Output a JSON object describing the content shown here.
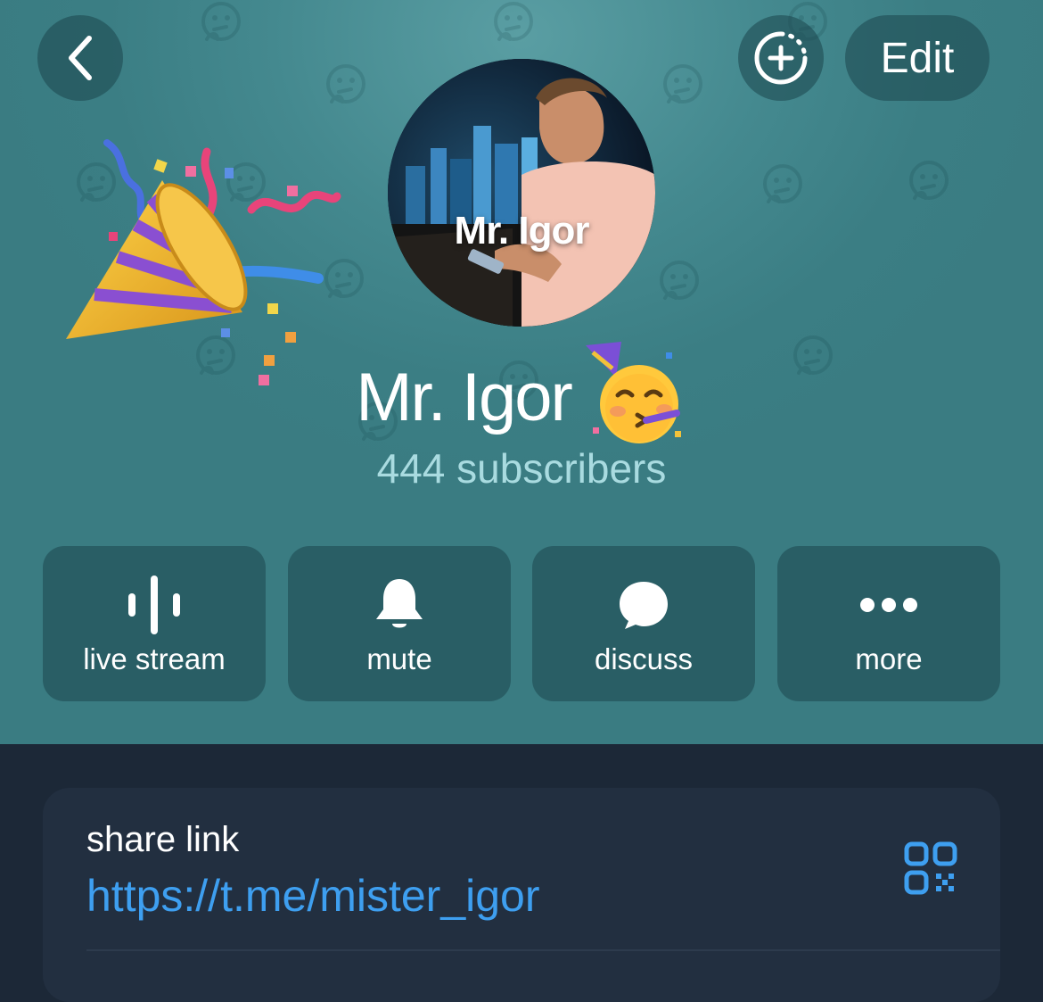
{
  "nav": {
    "back_icon": "chevron-left-icon",
    "story_icon": "add-story-icon",
    "edit_label": "Edit"
  },
  "profile": {
    "avatar_text": "Mr. Igor",
    "name": "Mr. Igor",
    "name_emoji": "partying-face-emoji",
    "decoration": "party-popper-emoji",
    "subscribers": "444 subscribers"
  },
  "actions": [
    {
      "label": "live stream",
      "icon": "live-stream-icon"
    },
    {
      "label": "mute",
      "icon": "bell-icon"
    },
    {
      "label": "discuss",
      "icon": "chat-bubble-icon"
    },
    {
      "label": "more",
      "icon": "more-dots-icon"
    }
  ],
  "share": {
    "title": "share link",
    "url": "https://t.me/mister_igor",
    "qr_icon": "qr-code-icon"
  },
  "colors": {
    "header_bg": "#3a7c82",
    "body_bg": "#1c2837",
    "card_bg": "#222f40",
    "link": "#3e9ff0",
    "subscribers_text": "#a9dbe0"
  }
}
